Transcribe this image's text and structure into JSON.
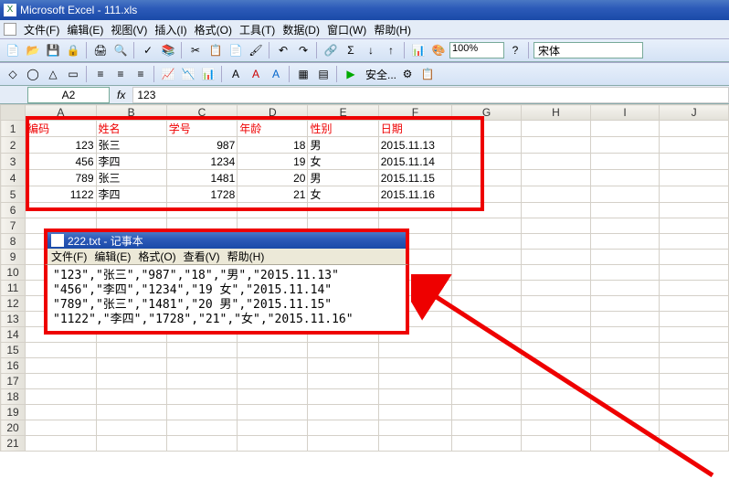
{
  "excel": {
    "title": "Microsoft Excel - 111.xls",
    "menus": [
      "文件(F)",
      "编辑(E)",
      "视图(V)",
      "插入(I)",
      "格式(O)",
      "工具(T)",
      "数据(D)",
      "窗口(W)",
      "帮助(H)"
    ],
    "zoom": "100%",
    "font": "宋体",
    "safety_label": "安全...",
    "namebox": "A2",
    "formula": "123",
    "columns": [
      "A",
      "B",
      "C",
      "D",
      "E",
      "F",
      "G",
      "H",
      "I",
      "J"
    ],
    "row_count": 21,
    "headers": [
      "编码",
      "姓名",
      "学号",
      "年龄",
      "性别",
      "日期"
    ],
    "rows": [
      {
        "a": "123",
        "b": "张三",
        "c": "987",
        "d": "18",
        "e": "男",
        "f": "2015.11.13"
      },
      {
        "a": "456",
        "b": "李四",
        "c": "1234",
        "d": "19",
        "e": "女",
        "f": "2015.11.14"
      },
      {
        "a": "789",
        "b": "张三",
        "c": "1481",
        "d": "20",
        "e": "男",
        "f": "2015.11.15"
      },
      {
        "a": "1122",
        "b": "李四",
        "c": "1728",
        "d": "21",
        "e": "女",
        "f": "2015.11.16"
      }
    ]
  },
  "notepad": {
    "title": "222.txt - 记事本",
    "menus": [
      "文件(F)",
      "编辑(E)",
      "格式(O)",
      "查看(V)",
      "帮助(H)"
    ],
    "lines": [
      "\"123\",\"张三\",\"987\",\"18\",\"男\",\"2015.11.13\"",
      "\"456\",\"李四\",\"1234\",\"19 女\",\"2015.11.14\"",
      "\"789\",\"张三\",\"1481\",\"20 男\",\"2015.11.15\"",
      "\"1122\",\"李四\",\"1728\",\"21\",\"女\",\"2015.11.16\""
    ]
  }
}
